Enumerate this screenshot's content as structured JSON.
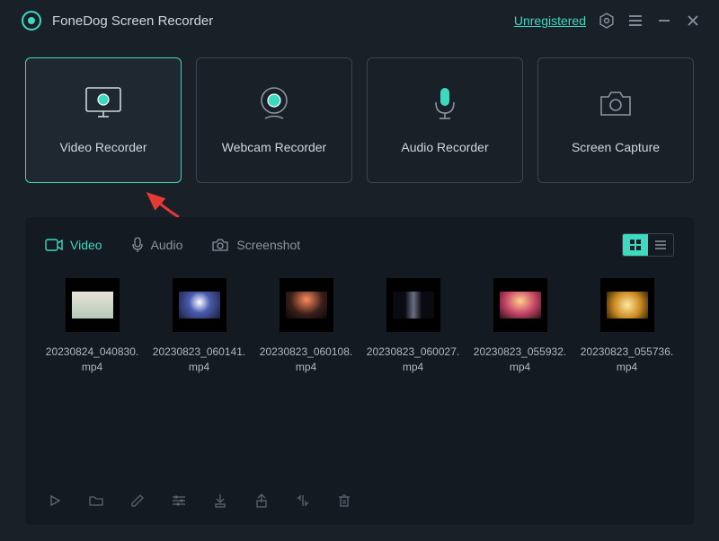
{
  "header": {
    "title": "FoneDog Screen Recorder",
    "unregistered": "Unregistered"
  },
  "cards": {
    "video": "Video Recorder",
    "webcam": "Webcam Recorder",
    "audio": "Audio Recorder",
    "capture": "Screen Capture"
  },
  "tabs": {
    "video": "Video",
    "audio": "Audio",
    "screenshot": "Screenshot"
  },
  "files": [
    {
      "name": "20230824_040830.mp4"
    },
    {
      "name": "20230823_060141.mp4"
    },
    {
      "name": "20230823_060108.mp4"
    },
    {
      "name": "20230823_060027.mp4"
    },
    {
      "name": "20230823_055932.mp4"
    },
    {
      "name": "20230823_055736.mp4"
    }
  ]
}
